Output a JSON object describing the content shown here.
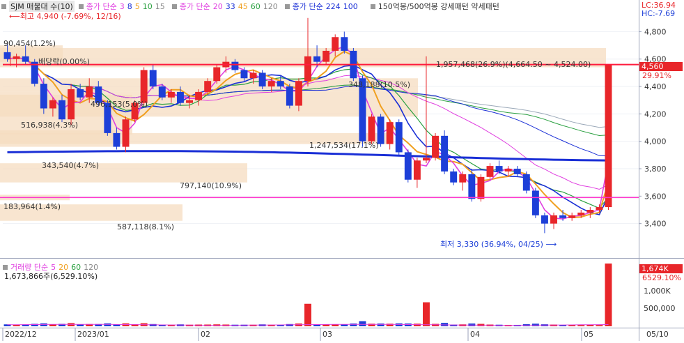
{
  "header": {
    "symbol_label": "SJM 매물대 수(10)",
    "ma_price_label": "종가 단순",
    "ma_price_periods": [
      "3",
      "8",
      "5",
      "10",
      "15"
    ],
    "ma_price_label2": "종가 단순",
    "ma_price_periods2": [
      "20",
      "33",
      "45",
      "60",
      "120"
    ],
    "ma_price_label3": "종가 단순",
    "ma_price_periods3": [
      "224",
      "100"
    ],
    "pattern_label": "150억봉/500억봉 강세패턴  약세패턴",
    "lc_text": "LC:36.94",
    "hc_text": "HC:-7.69"
  },
  "annotations": {
    "high_text": "최고 4,940 (-7.69%, 12/16)",
    "low_text": "최저 3,330 (36.94%, 04/25)",
    "dividend_text": "배당락(0.00%)",
    "current_price": "4,560",
    "current_pct": "29.91%"
  },
  "volume_profile_labels": [
    "90,454(1.2%)",
    "516,938(4.3%)",
    "496,153(5.0%)",
    "343,540(4.7%)",
    "797,140(10.9%)",
    "183,964(1.4%)",
    "587,118(8.1%)",
    "1,957,468(26.9%)(4,664.50 ~ 4,524.00)",
    "348,188(10.5%)",
    "1,247,534(17.1%)"
  ],
  "volume_pane": {
    "title": "거래량 단순",
    "periods": [
      "5",
      "20",
      "60",
      "120"
    ],
    "value_text": "1,673,866주(6,529.10%)",
    "current_value": "1,674K",
    "current_pct": "6529.10%",
    "axis_labels": [
      "1,000K",
      "500,000"
    ]
  },
  "x_axis_labels": [
    "2022/12",
    "2023/01",
    "02",
    "03",
    "04",
    "05",
    "05/10"
  ],
  "price_axis_labels": [
    "4,800",
    "4,600",
    "4,400",
    "4,200",
    "4,000",
    "3,800",
    "3,600",
    "3,400"
  ],
  "colors": {
    "up": "#e8262a",
    "down": "#1d3fd8",
    "profile": "#f5dcc0",
    "hline_red": "#ff1a3c",
    "hline_magenta": "#ff33cc",
    "ma224": "#1a2fd6",
    "ma_orange": "#f0a020",
    "ma_magenta": "#e040e0"
  },
  "chart_data": [
    {
      "type": "candlestick",
      "title": "SJM",
      "x_categories": [
        "2022/12",
        "2023/01",
        "02",
        "03",
        "04",
        "05",
        "05/10"
      ],
      "y_ticks": [
        3400,
        3600,
        3800,
        4000,
        4200,
        4400,
        4600,
        4800
      ],
      "ylim": [
        3200,
        4980
      ],
      "ohlc_approx": [
        [
          4650,
          4720,
          4580,
          4600
        ],
        [
          4600,
          4640,
          4540,
          4620
        ],
        [
          4620,
          4700,
          4560,
          4580
        ],
        [
          4580,
          4600,
          4400,
          4420
        ],
        [
          4420,
          4460,
          4200,
          4240
        ],
        [
          4240,
          4320,
          4180,
          4300
        ],
        [
          4300,
          4340,
          4140,
          4160
        ],
        [
          4160,
          4420,
          4120,
          4380
        ],
        [
          4380,
          4420,
          4300,
          4320
        ],
        [
          4320,
          4460,
          4280,
          4400
        ],
        [
          4400,
          4440,
          4260,
          4280
        ],
        [
          4280,
          4300,
          4040,
          4060
        ],
        [
          4060,
          4100,
          3940,
          3960
        ],
        [
          3960,
          4180,
          3920,
          4160
        ],
        [
          4160,
          4300,
          4140,
          4280
        ],
        [
          4280,
          4540,
          4260,
          4520
        ],
        [
          4520,
          4560,
          4380,
          4400
        ],
        [
          4400,
          4420,
          4300,
          4320
        ],
        [
          4320,
          4380,
          4280,
          4360
        ],
        [
          4360,
          4400,
          4260,
          4280
        ],
        [
          4280,
          4340,
          4240,
          4300
        ],
        [
          4300,
          4380,
          4260,
          4360
        ],
        [
          4360,
          4460,
          4340,
          4440
        ],
        [
          4440,
          4560,
          4420,
          4540
        ],
        [
          4540,
          4620,
          4500,
          4580
        ],
        [
          4580,
          4600,
          4500,
          4520
        ],
        [
          4520,
          4540,
          4440,
          4460
        ],
        [
          4460,
          4520,
          4420,
          4500
        ],
        [
          4500,
          4520,
          4380,
          4400
        ],
        [
          4400,
          4460,
          4360,
          4440
        ],
        [
          4440,
          4480,
          4380,
          4400
        ],
        [
          4400,
          4420,
          4240,
          4260
        ],
        [
          4260,
          4460,
          4220,
          4440
        ],
        [
          4440,
          4900,
          4400,
          4620
        ],
        [
          4620,
          4700,
          4540,
          4580
        ],
        [
          4580,
          4680,
          4560,
          4660
        ],
        [
          4660,
          4780,
          4620,
          4760
        ],
        [
          4760,
          4800,
          4640,
          4660
        ],
        [
          4660,
          4680,
          4440,
          4460
        ],
        [
          4460,
          4480,
          3960,
          4000
        ],
        [
          4000,
          4200,
          3980,
          4180
        ],
        [
          4180,
          4200,
          3960,
          3980
        ],
        [
          3980,
          4160,
          3940,
          4140
        ],
        [
          4140,
          4160,
          3900,
          3920
        ],
        [
          3920,
          3940,
          3700,
          3720
        ],
        [
          3720,
          3880,
          3660,
          3860
        ],
        [
          3860,
          4620,
          3840,
          3880
        ],
        [
          3880,
          4060,
          3860,
          4040
        ],
        [
          4040,
          4080,
          3760,
          3780
        ],
        [
          3780,
          3800,
          3680,
          3700
        ],
        [
          3700,
          3780,
          3640,
          3760
        ],
        [
          3760,
          3800,
          3560,
          3580
        ],
        [
          3580,
          3760,
          3560,
          3740
        ],
        [
          3740,
          3840,
          3720,
          3820
        ],
        [
          3820,
          3860,
          3760,
          3780
        ],
        [
          3780,
          3820,
          3740,
          3800
        ],
        [
          3800,
          3820,
          3740,
          3760
        ],
        [
          3760,
          3780,
          3620,
          3640
        ],
        [
          3640,
          3660,
          3440,
          3460
        ],
        [
          3460,
          3480,
          3330,
          3400
        ],
        [
          3400,
          3480,
          3360,
          3460
        ],
        [
          3460,
          3500,
          3420,
          3440
        ],
        [
          3440,
          3480,
          3420,
          3460
        ],
        [
          3460,
          3500,
          3440,
          3480
        ],
        [
          3480,
          3520,
          3440,
          3500
        ],
        [
          3500,
          3540,
          3480,
          3520
        ],
        [
          3520,
          4560,
          3500,
          4560
        ]
      ],
      "hlines": [
        4560,
        3590
      ],
      "ma224_level": 3920
    },
    {
      "type": "bar",
      "title": "거래량",
      "current_volume": 1673866,
      "yticks": [
        500000,
        1000000
      ]
    }
  ]
}
